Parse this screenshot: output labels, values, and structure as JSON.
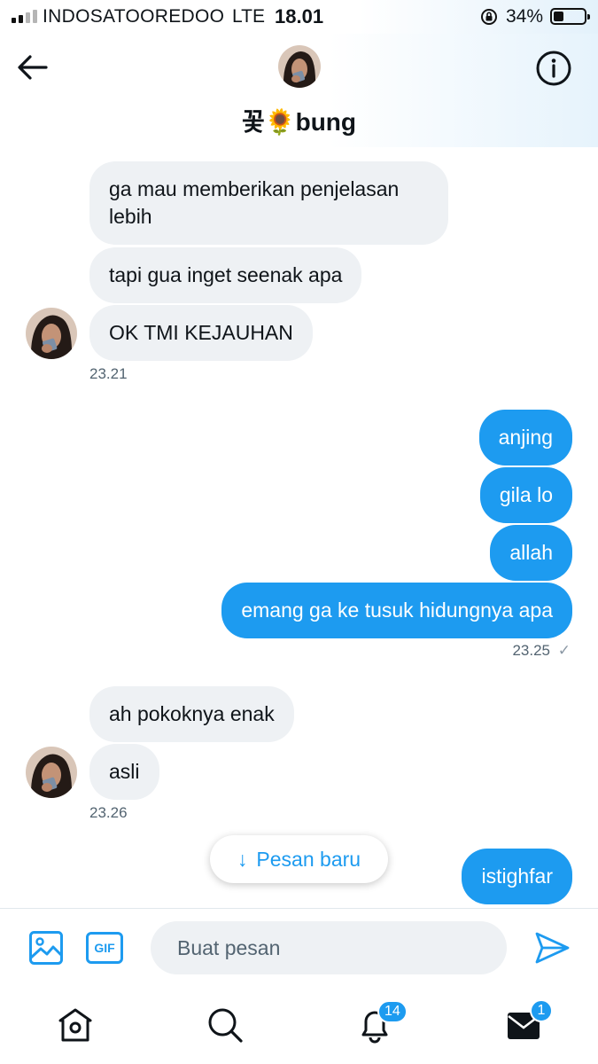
{
  "status_bar": {
    "carrier": "INDOSATOOREDOO",
    "network": "LTE",
    "time": "18.01",
    "battery_percent": "34%",
    "battery_level": 0.34
  },
  "header": {
    "back_icon": "arrow-left-icon",
    "title": "꽃🌻bung",
    "info_icon": "info-circle-icon"
  },
  "messages": [
    {
      "text": "ga mau memberikan penjelasan lebih",
      "direction": "in"
    },
    {
      "text": "tapi gua inget seenak apa",
      "direction": "in"
    },
    {
      "text": "OK TMI KEJAUHAN",
      "direction": "in"
    },
    {
      "text": "anjing",
      "direction": "out"
    },
    {
      "text": "gila lo",
      "direction": "out"
    },
    {
      "text": "allah",
      "direction": "out"
    },
    {
      "text": "emang ga ke tusuk hidungnya apa",
      "direction": "out"
    },
    {
      "text": "ah pokoknya enak",
      "direction": "in"
    },
    {
      "text": "asli",
      "direction": "in"
    },
    {
      "text": "istighfar",
      "direction": "out"
    }
  ],
  "timestamps": [
    "23.21",
    "23.25",
    "23.26"
  ],
  "read_check": "✓",
  "new_messages_pill": {
    "arrow": "↓",
    "label": "Pesan baru"
  },
  "composer": {
    "media_icon": "image-icon",
    "gif_label": "GIF",
    "placeholder": "Buat pesan",
    "send_icon": "send-icon"
  },
  "bottom_nav": {
    "home_icon": "home-icon",
    "search_icon": "search-icon",
    "notifications_icon": "bell-icon",
    "notifications_badge": "14",
    "messages_icon": "mail-icon",
    "messages_badge": "1"
  },
  "colors": {
    "accent": "#1d9bf0",
    "incoming_bubble": "#eef1f4",
    "text": "#0f1419",
    "muted": "#536471"
  }
}
